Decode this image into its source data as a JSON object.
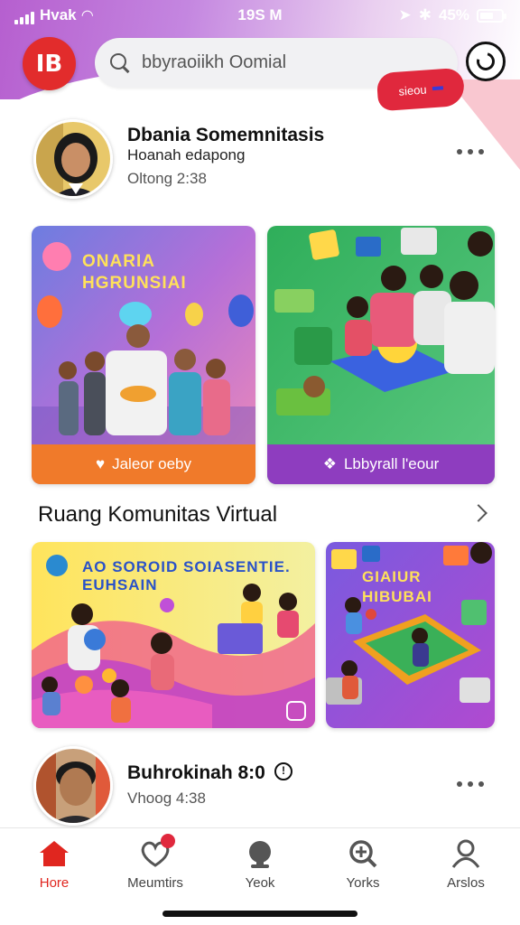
{
  "status": {
    "carrier": "Hvak",
    "time": "19S M",
    "battery": "45%"
  },
  "header": {
    "logo_text": "IB",
    "search_placeholder": "bbyraoiikh Oomial",
    "badge_text": "sieou"
  },
  "post1": {
    "name": "Dbania Somemnitasis",
    "subtitle": "Hoanah edapong",
    "time": "Oltong 2:38"
  },
  "cards_row1": [
    {
      "title": "ONARIA HGRUNSIAI",
      "footer": "Jaleor oeby",
      "color": "#f07a2a"
    },
    {
      "title": "",
      "footer": "Lbbyrall l'eour",
      "color": "#8e3dbf"
    }
  ],
  "section": {
    "title": "Ruang Komunitas Virtual"
  },
  "cards_row2": [
    {
      "title": "AO SOROID SOIASENTIE. EUHSAIN"
    },
    {
      "title": "GIAIUR HIBUBAI"
    }
  ],
  "post2": {
    "name": "Buhrokinah 8:0",
    "time": "Vhoog 4:38"
  },
  "nav": [
    {
      "label": "Hore",
      "icon": "home-icon",
      "active": true
    },
    {
      "label": "Meumtirs",
      "icon": "heart-icon",
      "active": false,
      "badge": ""
    },
    {
      "label": "Yeok",
      "icon": "person-icon",
      "active": false
    },
    {
      "label": "Yorks",
      "icon": "search-icon",
      "active": false
    },
    {
      "label": "Arslos",
      "icon": "profile-icon",
      "active": false
    }
  ],
  "colors": {
    "accent": "#e0261f",
    "header_purple": "#b65fcf"
  }
}
